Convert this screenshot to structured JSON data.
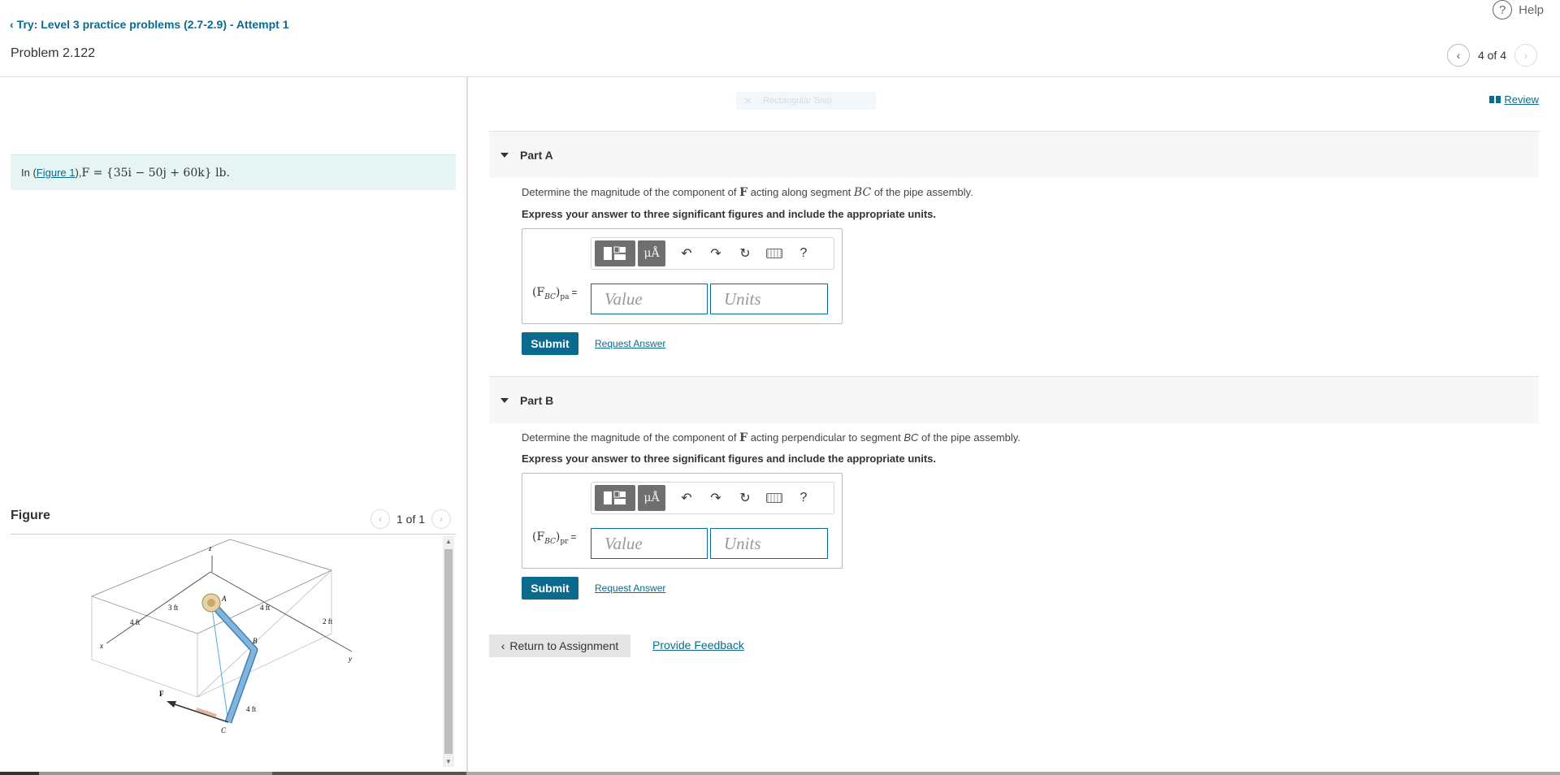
{
  "header": {
    "breadcrumb": "Try: Level 3 practice problems (2.7-2.9) - Attempt 1",
    "problem_title": "Problem 2.122",
    "help_label": "Help",
    "help_glyph": "?",
    "pager_text": "4 of 4"
  },
  "problem": {
    "prefix": "In (",
    "figure_link": "Figure 1",
    "suffix": "), ",
    "formula": "F = {35i − 50j + 60k} lb."
  },
  "figure": {
    "title": "Figure",
    "pager_text": "1 of 1",
    "labels": {
      "z": "z",
      "x": "x",
      "y": "y",
      "A": "A",
      "B": "B",
      "C": "C",
      "F": "F",
      "d4ft_left": "4 ft",
      "d3ft": "3 ft",
      "d4ft_top": "4 ft",
      "d2ft": "2 ft",
      "d4ft_vert": "4 ft"
    }
  },
  "right": {
    "snip_label": "Rectangular Snip",
    "review_label": "Review",
    "return_label": "Return to Assignment",
    "feedback_label": "Provide Feedback"
  },
  "parts": [
    {
      "title": "Part A",
      "q_prefix": "Determine the magnitude of the component of",
      "q_F": "F",
      "q_middle": "acting along segment",
      "q_seg": "BC",
      "q_suffix": "of the pipe assembly.",
      "instruction": "Express your answer to three significant figures and include the appropriate units.",
      "label_main": "(F",
      "label_sub": "BC",
      "label_close": ")",
      "label_sub2": "pa",
      "label_eq": "=",
      "value_placeholder": "Value",
      "units_placeholder": "Units",
      "submit": "Submit",
      "request": "Request Answer",
      "toolbar_mu": "μÅ",
      "toolbar_help": "?"
    },
    {
      "title": "Part B",
      "q_prefix": "Determine the magnitude of the component of",
      "q_F": "F",
      "q_middle": "acting perpendicular to segment",
      "q_seg": "BC",
      "q_suffix": "of the pipe assembly.",
      "instruction": "Express your answer to three significant figures and include the appropriate units.",
      "label_main": "(F",
      "label_sub": "BC",
      "label_close": ")",
      "label_sub2": "pr",
      "label_eq": "=",
      "value_placeholder": "Value",
      "units_placeholder": "Units",
      "submit": "Submit",
      "request": "Request Answer",
      "toolbar_mu": "μÅ",
      "toolbar_help": "?"
    }
  ],
  "colors": {
    "accent": "#0b6b8f",
    "problem_bg": "#e6f4f3",
    "pipe": "#7fb6e0"
  }
}
